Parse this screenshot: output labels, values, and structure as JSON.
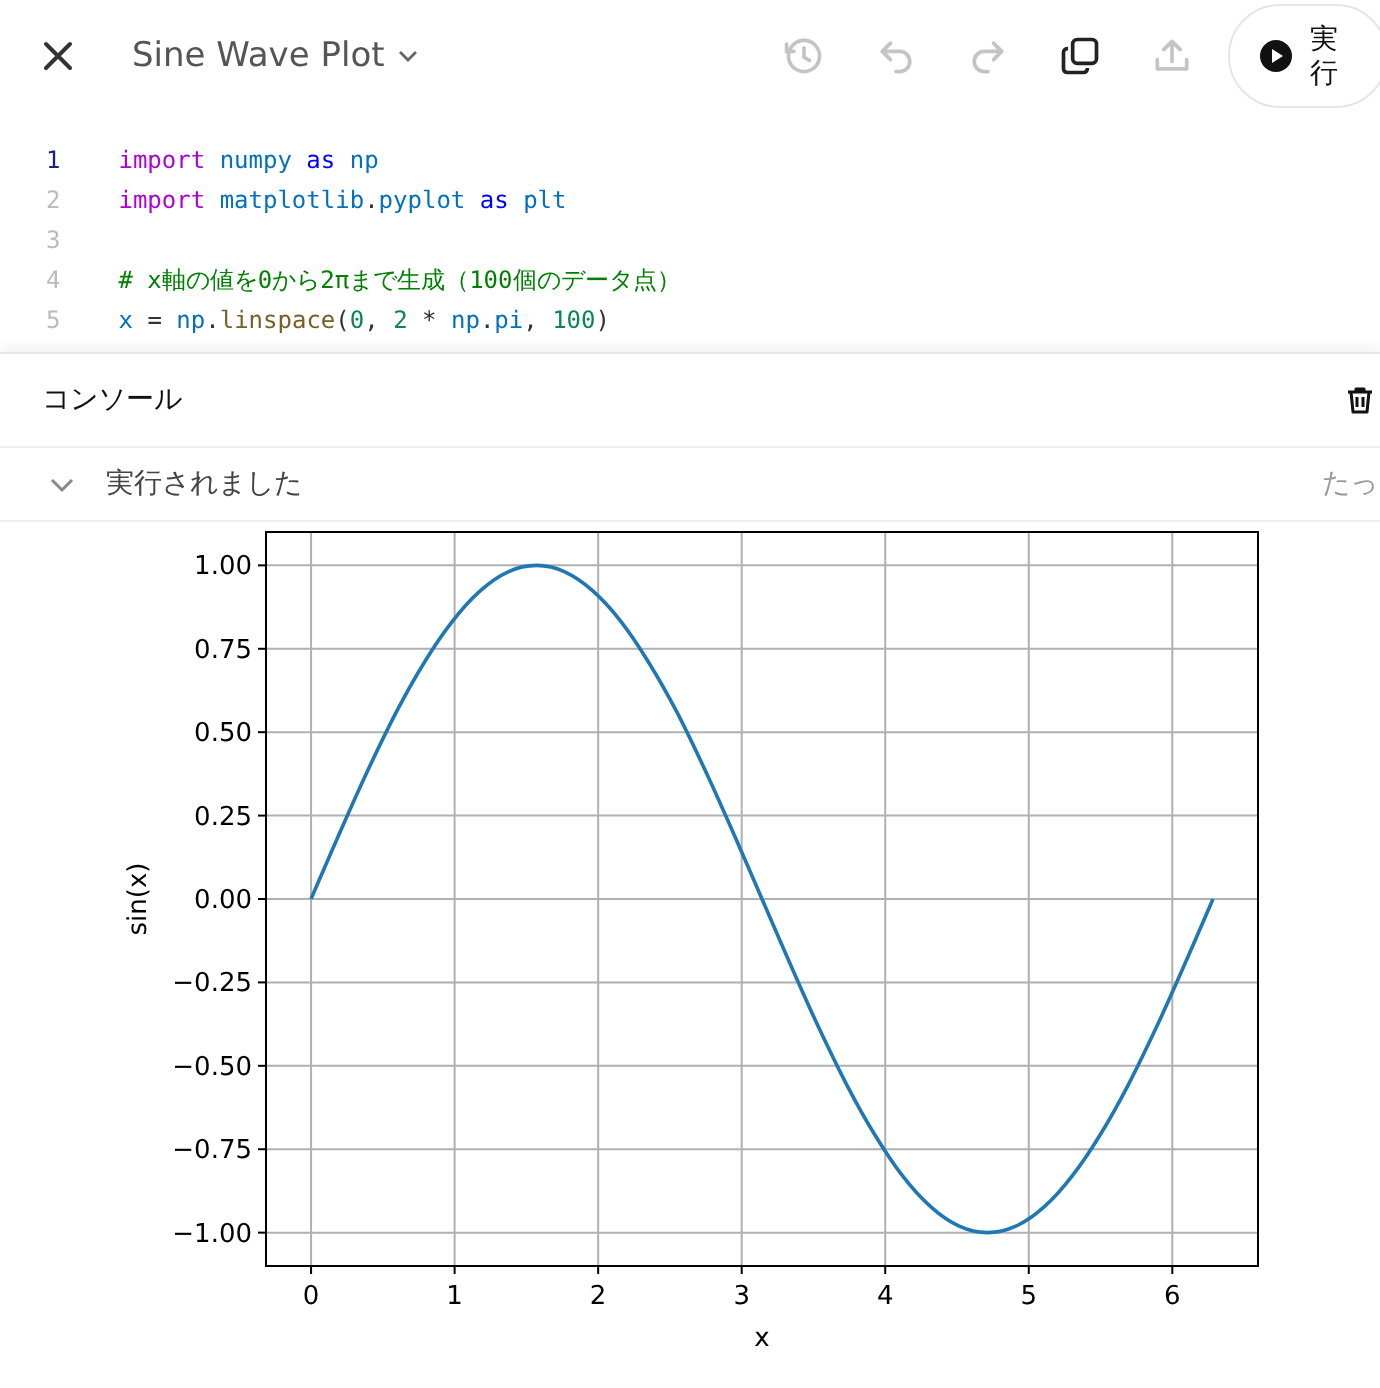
{
  "header": {
    "title": "Sine Wave Plot",
    "toolbar": [
      {
        "kind": "history",
        "disabled": true
      },
      {
        "kind": "undo",
        "disabled": true
      },
      {
        "kind": "redo",
        "disabled": true
      },
      {
        "kind": "copy",
        "disabled": false
      },
      {
        "kind": "upload",
        "disabled": true
      }
    ],
    "run_button": "実行"
  },
  "editor": {
    "lines": [
      {
        "number": "1",
        "active": true,
        "tokens": [
          {
            "text": "import ",
            "kind": "keyword"
          },
          {
            "text": "numpy ",
            "kind": "name"
          },
          {
            "text": "as ",
            "kind": "as"
          },
          {
            "text": "np",
            "kind": "name"
          }
        ]
      },
      {
        "number": "2",
        "active": false,
        "tokens": [
          {
            "text": "import ",
            "kind": "keyword"
          },
          {
            "text": "matplotlib",
            "kind": "name"
          },
          {
            "text": ".",
            "kind": "plain"
          },
          {
            "text": "pyplot ",
            "kind": "name"
          },
          {
            "text": "as ",
            "kind": "as"
          },
          {
            "text": "plt",
            "kind": "name"
          }
        ]
      },
      {
        "number": "3",
        "active": false
      },
      {
        "number": "4",
        "active": false,
        "tokens": [
          {
            "text": "# x軸の値を0から2πまで生成（100個のデータ点）",
            "kind": "comment"
          }
        ]
      },
      {
        "number": "5",
        "active": false,
        "tokens": [
          {
            "text": "x",
            "kind": "name"
          },
          {
            "text": " = ",
            "kind": "plain"
          },
          {
            "text": "np",
            "kind": "name"
          },
          {
            "text": ".",
            "kind": "plain"
          },
          {
            "text": "linspace",
            "kind": "function"
          },
          {
            "text": "(",
            "kind": "plain"
          },
          {
            "text": "0",
            "kind": "number"
          },
          {
            "text": ", ",
            "kind": "plain"
          },
          {
            "text": "2",
            "kind": "number"
          },
          {
            "text": " * ",
            "kind": "plain"
          },
          {
            "text": "np",
            "kind": "name"
          },
          {
            "text": ".",
            "kind": "plain"
          },
          {
            "text": "pi",
            "kind": "name"
          },
          {
            "text": ", ",
            "kind": "plain"
          },
          {
            "text": "100",
            "kind": "number"
          },
          {
            "text": ")",
            "kind": "plain"
          }
        ]
      }
    ]
  },
  "console": {
    "title": "コンソール",
    "output": {
      "expanded": true,
      "status": "実行されました",
      "time": "たっ"
    },
    "chart_data": {
      "type": "line",
      "xlabel": "x",
      "ylabel": "sin(x)",
      "grid": true,
      "x": [
        0,
        0.196,
        0.393,
        0.589,
        0.785,
        0.982,
        1.178,
        1.374,
        1.571,
        1.767,
        1.963,
        2.16,
        2.356,
        2.553,
        2.749,
        2.945,
        3.142,
        3.338,
        3.534,
        3.731,
        3.927,
        4.123,
        4.32,
        4.516,
        4.712,
        4.909,
        5.105,
        5.301,
        5.498,
        5.694,
        5.89,
        6.087,
        6.283
      ],
      "series": [
        {
          "color": "#1f77b4",
          "values": [
            0,
            0.195,
            0.383,
            0.556,
            0.707,
            0.831,
            0.924,
            0.981,
            1,
            0.981,
            0.924,
            0.831,
            0.707,
            0.556,
            0.383,
            0.195,
            0,
            -0.195,
            -0.383,
            -0.556,
            -0.707,
            -0.831,
            -0.924,
            -0.981,
            -1,
            -0.981,
            -0.924,
            -0.831,
            -0.707,
            -0.556,
            -0.383,
            -0.195,
            0
          ]
        }
      ],
      "xlim": [
        -0.314,
        6.597
      ],
      "ylim": [
        -1.1,
        1.1
      ],
      "xticks": [
        0,
        1,
        2,
        3,
        4,
        5,
        6
      ],
      "yticks": [
        {
          "value": 1,
          "label": "1.00"
        },
        {
          "value": 0.75,
          "label": "0.75"
        },
        {
          "value": 0.5,
          "label": "0.50"
        },
        {
          "value": 0.25,
          "label": "0.25"
        },
        {
          "value": 0,
          "label": "0.00"
        },
        {
          "value": -0.25,
          "label": "−0.25"
        },
        {
          "value": -0.5,
          "label": "−0.50"
        },
        {
          "value": -0.75,
          "label": "−0.75"
        },
        {
          "value": -1,
          "label": "−1.00"
        }
      ]
    }
  }
}
